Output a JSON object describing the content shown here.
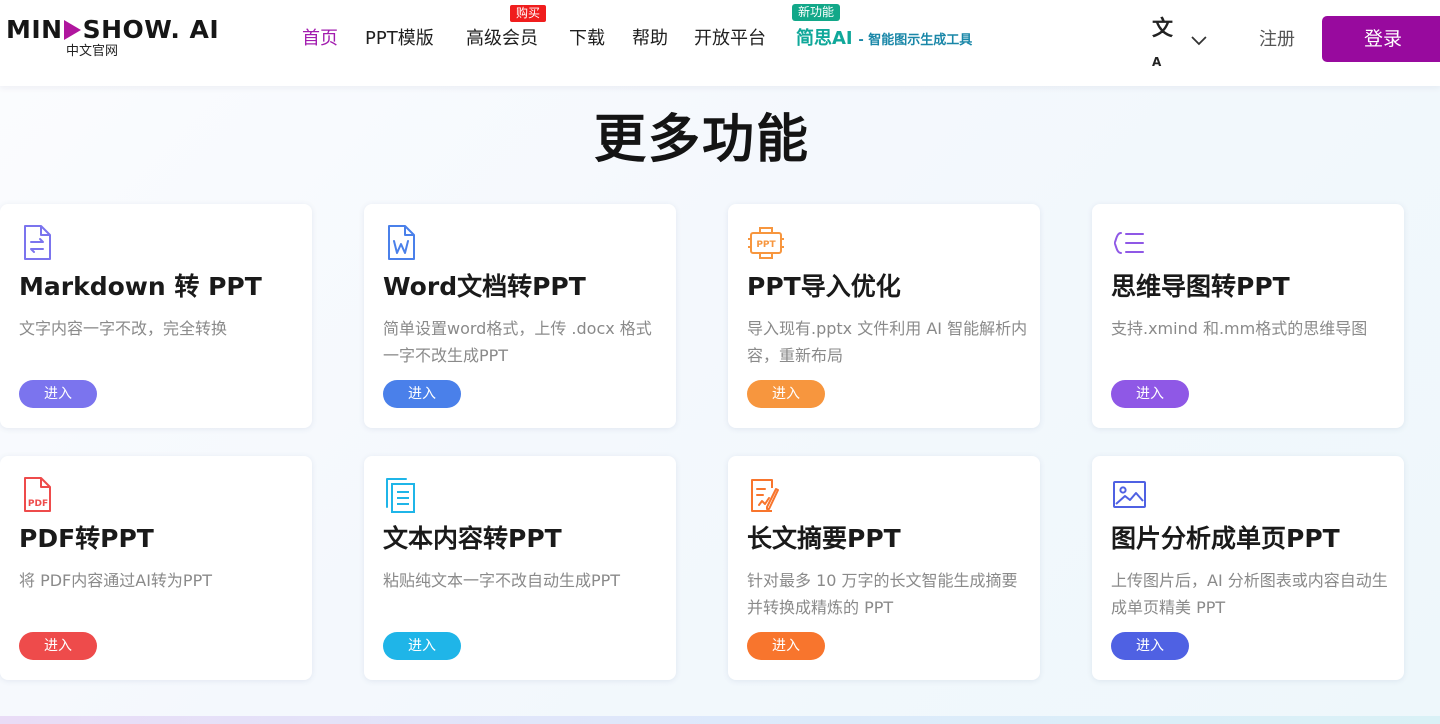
{
  "header": {
    "logo": {
      "name": "MINDSHOW.AI",
      "name_prefix": "MIN",
      "name_suffix": "SHOW. AI",
      "sub": "中文官网",
      "accent": "#b0169e"
    },
    "nav": [
      {
        "label": "首页",
        "active": true
      },
      {
        "label": "PPT模版"
      },
      {
        "label": "高级会员",
        "badge": "购买"
      },
      {
        "label": "下载"
      },
      {
        "label": "帮助"
      },
      {
        "label": "开放平台"
      },
      {
        "label": "简思AI",
        "badge": "新功能",
        "sub": "- 智能图示生成工具"
      }
    ],
    "language_icon": "translate-icon",
    "register_label": "注册",
    "login_label": "登录",
    "colors": {
      "active": "#a21caf",
      "login_bg": "#980a9e",
      "badge_red": "#f01d1d",
      "badge_green": "#12a889"
    }
  },
  "section": {
    "title": "更多功能"
  },
  "cards": [
    {
      "title": "Markdown 转 PPT",
      "desc": "文字内容一字不改，完全转换",
      "button": "进入",
      "icon": "markdown-file-icon",
      "color": "#7b74ee"
    },
    {
      "title": "Word文档转PPT",
      "desc": "简单设置word格式，上传 .docx 格式一字不改生成PPT",
      "button": "进入",
      "icon": "word-file-icon",
      "color": "#4a80ea"
    },
    {
      "title": "PPT导入优化",
      "desc": "导入现有.pptx 文件利用 AI 智能解析内容，重新布局",
      "button": "进入",
      "icon": "ppt-icon",
      "color": "#f7963e"
    },
    {
      "title": "思维导图转PPT",
      "desc": "支持.xmind 和.mm格式的思维导图",
      "button": "进入",
      "icon": "mindmap-icon",
      "color": "#8f58e6"
    },
    {
      "title": "PDF转PPT",
      "desc": "将 PDF内容通过AI转为PPT",
      "button": "进入",
      "icon": "pdf-file-icon",
      "color": "#ee4b4b"
    },
    {
      "title": "文本内容转PPT",
      "desc": "粘贴纯文本一字不改自动生成PPT",
      "button": "进入",
      "icon": "text-copy-icon",
      "color": "#1fb5e8"
    },
    {
      "title": "长文摘要PPT",
      "desc": "针对最多 10 万字的长文智能生成摘要并转换成精炼的 PPT",
      "button": "进入",
      "icon": "summary-edit-icon",
      "color": "#f8752d"
    },
    {
      "title": "图片分析成单页PPT",
      "desc": "上传图片后，AI 分析图表或内容自动生成单页精美 PPT",
      "button": "进入",
      "icon": "image-icon",
      "color": "#4f61e3"
    }
  ]
}
